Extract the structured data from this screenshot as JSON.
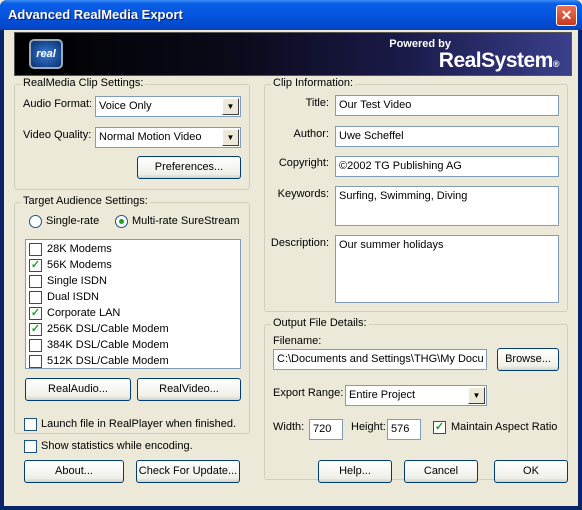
{
  "window": {
    "title": "Advanced RealMedia Export",
    "close_glyph": "✕"
  },
  "banner": {
    "logo_text": "real",
    "powered_by": "Powered by",
    "brand": "RealSystem",
    "brand_mark": "®"
  },
  "clip_settings": {
    "label": "RealMedia Clip Settings:",
    "audio_format_label": "Audio Format:",
    "audio_format_value": "Voice Only",
    "video_quality_label": "Video Quality:",
    "video_quality_value": "Normal Motion Video",
    "preferences_button": "Preferences..."
  },
  "target_audience": {
    "label": "Target Audience Settings:",
    "single_rate": "Single-rate",
    "multi_rate": "Multi-rate SureStream",
    "selected_mode": "multi-rate",
    "items": [
      {
        "label": "28K Modems",
        "checked": false
      },
      {
        "label": "56K Modems",
        "checked": true
      },
      {
        "label": "Single ISDN",
        "checked": false
      },
      {
        "label": "Dual ISDN",
        "checked": false
      },
      {
        "label": "Corporate LAN",
        "checked": true
      },
      {
        "label": "256K DSL/Cable Modem",
        "checked": true
      },
      {
        "label": "384K DSL/Cable Modem",
        "checked": false
      },
      {
        "label": "512K DSL/Cable Modem",
        "checked": false
      }
    ],
    "realaudio_button": "RealAudio...",
    "realvideo_button": "RealVideo..."
  },
  "options": {
    "launch_label": "Launch file in RealPlayer when finished.",
    "launch_checked": false,
    "stats_label": "Show statistics while encoding.",
    "stats_checked": false
  },
  "clip_info": {
    "label": "Clip Information:",
    "title_label": "Title:",
    "title_value": "Our Test Video",
    "author_label": "Author:",
    "author_value": "Uwe Scheffel",
    "copyright_label": "Copyright:",
    "copyright_value": "©2002 TG Publishing AG",
    "keywords_label": "Keywords:",
    "keywords_value": "Surfing, Swimming, Diving",
    "description_label": "Description:",
    "description_value": "Our summer holidays"
  },
  "output": {
    "label": "Output File Details:",
    "filename_label": "Filename:",
    "filename_value": "C:\\Documents and Settings\\THG\\My Docu",
    "browse_button": "Browse...",
    "export_range_label": "Export Range:",
    "export_range_value": "Entire Project",
    "width_label": "Width:",
    "width_value": "720",
    "height_label": "Height:",
    "height_value": "576",
    "aspect_label": "Maintain Aspect Ratio",
    "aspect_checked": true
  },
  "buttons": {
    "about": "About...",
    "check_update": "Check For Update...",
    "help": "Help...",
    "cancel": "Cancel",
    "ok": "OK"
  },
  "icons": {
    "combo_arrow": "▼",
    "check": "✓"
  }
}
